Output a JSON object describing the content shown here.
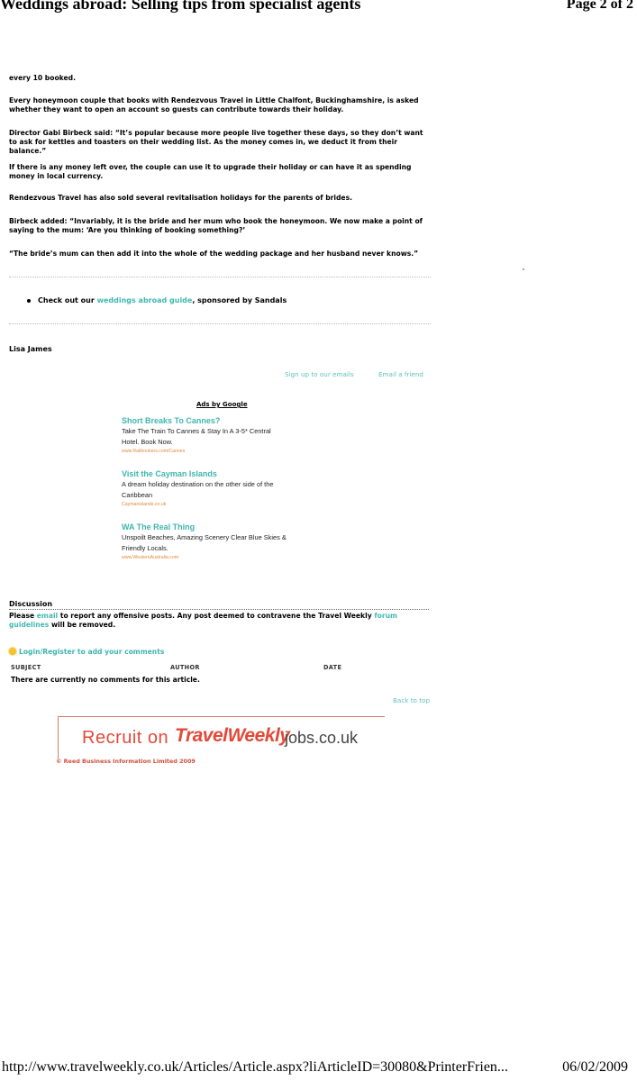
{
  "print_header": {
    "title": "Weddings abroad: Selling tips from specialist agents",
    "page": "Page 2 of 2"
  },
  "article": {
    "paragraphs": [
      "every 10 booked.",
      "Every honeymoon couple that books with Rendezvous Travel in Little Chalfont, Buckinghamshire, is asked whether they want to open an account so guests can contribute towards their holiday.",
      "Director Gabi Birbeck said: “It’s popular because more people live together these days, so they don’t want to ask for kettles and toasters on their wedding list. As the money comes in, we deduct it from their balance.”",
      "If there is any money left over, the couple can use it to upgrade their holiday or can have it as spending money in local currency.",
      "Rendezvous Travel has also sold several revitalisation holidays for the parents of brides.",
      "Birbeck added: “Invariably, it is the bride and her mum who book the honeymoon. We now make a point of saying to the mum: ‘Are you thinking of booking something?’",
      "“The bride’s mum can then add it into the whole of the wedding package and her husband never knows.”"
    ],
    "promo": {
      "prefix": "Check out our ",
      "link": "weddings abroad guide",
      "suffix": ", sponsored by Sandals"
    },
    "author": "Lisa James"
  },
  "utility_links": {
    "signup": "Sign up to our emails",
    "email_friend": "Email a friend"
  },
  "ads": {
    "heading": "Ads by Google",
    "items": [
      {
        "title": "Short Breaks To Cannes?",
        "line1": "Take The Train To Cannes & Stay In A 3-5* Central",
        "line2": "Hotel. Book Now.",
        "url": "www.Railbookers.com/Cannes"
      },
      {
        "title": "Visit the Cayman Islands",
        "line1": "A dream holiday destination on the other side of the",
        "line2": "Caribbean",
        "url": "Caymanislands.co.uk"
      },
      {
        "title": "WA The Real Thing",
        "line1": "Unspoilt Beaches, Amazing Scenery Clear Blue Skies &",
        "line2": "Friendly Locals.",
        "url": "www.WesternAustralia.com"
      }
    ]
  },
  "discussion": {
    "heading": "Discussion",
    "text_before": "Please ",
    "email_link": "email",
    "text_middle": " to report any offensive posts. Any post deemed to contravene the Travel Weekly ",
    "forum_link": "forum guidelines",
    "text_after": " will be removed.",
    "login": "Login/Register to add your comments",
    "columns": [
      "SUBJECT",
      "AUTHOR",
      "DATE"
    ],
    "no_comments": "There are currently no comments for this article.",
    "back_to_top": "Back to top"
  },
  "banner": {
    "recruit": "Recruit on",
    "brand": "TravelWeekly",
    "domain": "jobs.co.uk"
  },
  "copyright": "© Reed Business Information Limited 2009",
  "print_footer": {
    "url": "http://www.travelweekly.co.uk/Articles/Article.aspx?liArticleID=30080&PrinterFrien...",
    "date": "06/02/2009"
  },
  "colors": {
    "link_teal": "#3fb8b0",
    "ad_url_orange": "#e08a3c",
    "banner_red": "#e24a38"
  }
}
